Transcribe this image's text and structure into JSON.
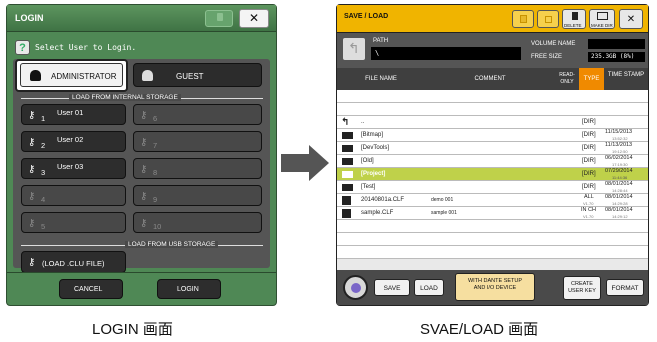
{
  "login_window": {
    "title": "LOGIN",
    "prompt": "Select User to Login.",
    "admin_label": "ADMINISTRATOR",
    "guest_label": "GUEST",
    "internal_label": "LOAD FROM INTERNAL STORAGE",
    "users": [
      {
        "num": "1",
        "name": "User 01"
      },
      {
        "num": "2",
        "name": "User 02"
      },
      {
        "num": "3",
        "name": "User 03"
      },
      {
        "num": "4",
        "name": ""
      },
      {
        "num": "5",
        "name": ""
      },
      {
        "num": "6",
        "name": ""
      },
      {
        "num": "7",
        "name": ""
      },
      {
        "num": "8",
        "name": ""
      },
      {
        "num": "9",
        "name": ""
      },
      {
        "num": "10",
        "name": ""
      }
    ],
    "usb_label": "LOAD FROM USB STORAGE",
    "load_file_label": "(LOAD .CLU FILE)",
    "cancel_label": "CANCEL",
    "login_label": "LOGIN"
  },
  "save_window": {
    "title": "SAVE / LOAD",
    "delete_label": "DELETE",
    "make_dir_label": "MAKE DIR",
    "path_label": "PATH",
    "path_value": "\\",
    "volume_label": "VOLUME NAME",
    "free_label": "FREE SIZE",
    "free_value": "235.3GB (8%)",
    "columns": {
      "file_name": "FILE NAME",
      "comment": "COMMENT",
      "read_only": "READ-ONLY",
      "type": "TYPE",
      "time_stamp": "TIME STAMP"
    },
    "rows": [
      {
        "name": "..",
        "comment": "",
        "type": "[DIR]",
        "date": "",
        "time": "",
        "icon": "up-icon"
      },
      {
        "name": "[Bitmap]",
        "comment": "",
        "type": "[DIR]",
        "date": "11/15/2013",
        "time": "13:52:32",
        "icon": "folder-icon"
      },
      {
        "name": "[DevTools]",
        "comment": "",
        "type": "[DIR]",
        "date": "11/13/2013",
        "time": "19:12:50",
        "icon": "folder-icon"
      },
      {
        "name": "[Old]",
        "comment": "",
        "type": "[DIR]",
        "date": "06/02/2014",
        "time": "17:19:30",
        "icon": "folder-icon"
      },
      {
        "name": "[Project]",
        "comment": "",
        "type": "[DIR]",
        "date": "07/29/2014",
        "time": "11:44:36",
        "icon": "folder-icon"
      },
      {
        "name": "[Test]",
        "comment": "",
        "type": "[DIR]",
        "date": "08/01/2014",
        "time": "14:28:44",
        "icon": "folder-icon"
      },
      {
        "name": "20140801a.CLF",
        "comment": "demo 001",
        "type": "ALL",
        "type2": "V1.70",
        "date": "08/01/2014",
        "time": "14:29:28",
        "icon": "file-icon"
      },
      {
        "name": "sample.CLF",
        "comment": "sample 001",
        "type": "IN CH",
        "type2": "V1.70",
        "date": "08/01/2014",
        "time": "14:29:12",
        "icon": "file-icon"
      }
    ],
    "save_label": "SAVE",
    "load_label": "LOAD",
    "with_label": "WITH DANTE SETUP AND I/O DEVICE",
    "create_key_label": "CREATE USER KEY",
    "format_label": "FORMAT"
  },
  "captions": {
    "left": "LOGIN 画面",
    "right": "SVAE/LOAD 画面"
  },
  "colors": {
    "login_bg": "#4f8855",
    "save_titlebar": "#f0b400",
    "selected_row": "#bfd14a",
    "type_header": "#f08a00"
  }
}
